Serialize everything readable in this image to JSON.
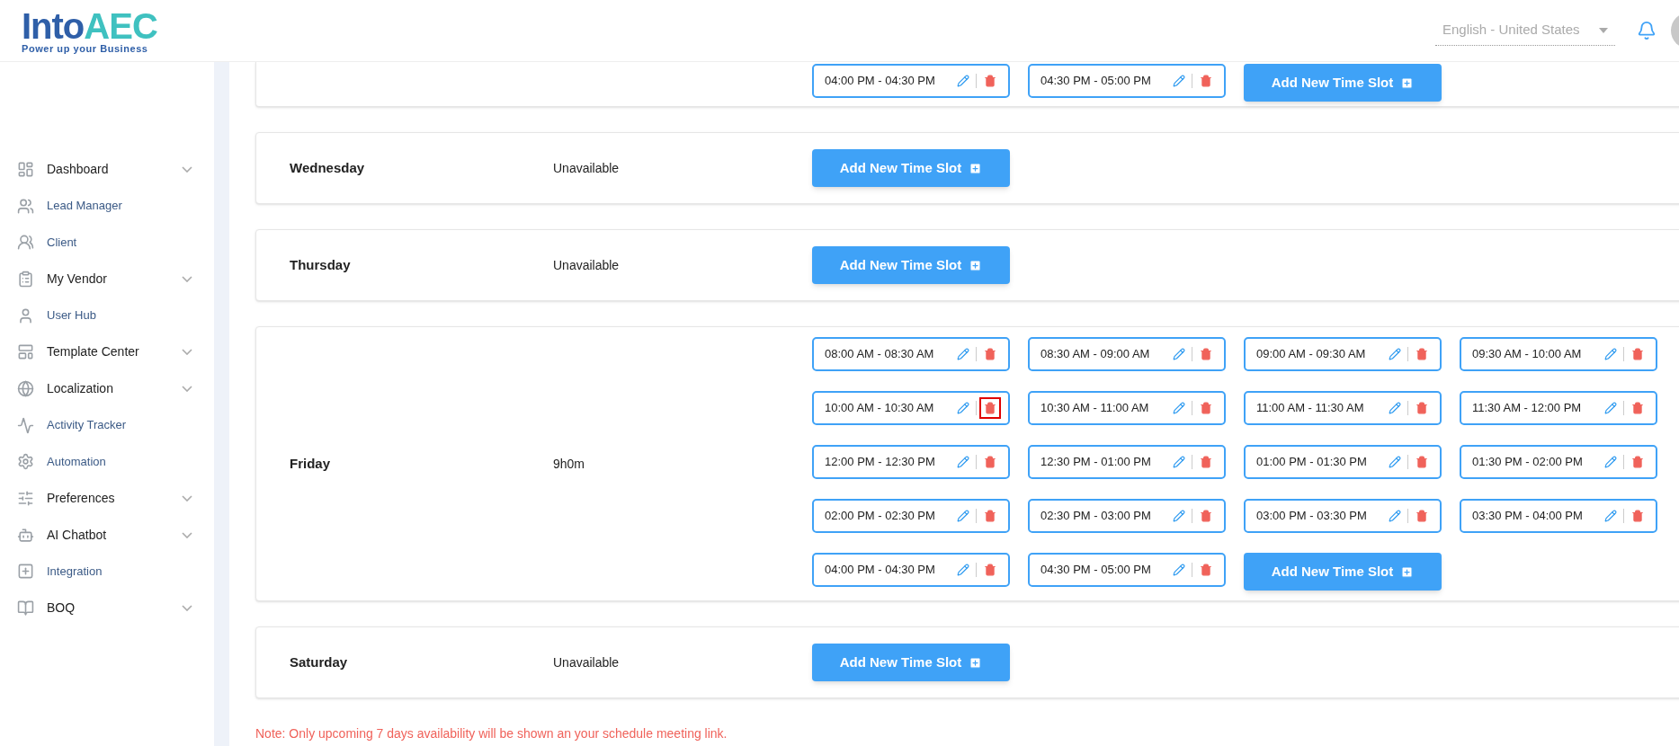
{
  "brand": {
    "name_start": "Into",
    "name_end": "AEC",
    "tagline": "Power up your Business"
  },
  "header": {
    "language": "English - United States"
  },
  "sidebar": {
    "items": [
      {
        "label": "Dashboard",
        "kind": "group"
      },
      {
        "label": "Lead Manager",
        "kind": "link"
      },
      {
        "label": "Client",
        "kind": "link"
      },
      {
        "label": "My Vendor",
        "kind": "group"
      },
      {
        "label": "User Hub",
        "kind": "link"
      },
      {
        "label": "Template Center",
        "kind": "group"
      },
      {
        "label": "Localization",
        "kind": "group"
      },
      {
        "label": "Activity Tracker",
        "kind": "link"
      },
      {
        "label": "Automation",
        "kind": "link"
      },
      {
        "label": "Preferences",
        "kind": "group"
      },
      {
        "label": "AI Chatbot",
        "kind": "group"
      },
      {
        "label": "Integration",
        "kind": "link"
      },
      {
        "label": "BOQ",
        "kind": "group"
      }
    ]
  },
  "clipped_card": {
    "slots": [
      {
        "time": "04:00 PM - 04:30 PM",
        "delete_focused": false
      },
      {
        "time": "04:30 PM - 05:00 PM",
        "delete_focused": false
      }
    ],
    "add_button": "Add New Time Slot"
  },
  "days": [
    {
      "day": "Wednesday",
      "status": "Unavailable",
      "add_button": "Add New Time Slot"
    },
    {
      "day": "Thursday",
      "status": "Unavailable",
      "add_button": "Add New Time Slot"
    },
    {
      "day": "Friday",
      "status": "9h0m",
      "slots": [
        {
          "time": "08:00 AM - 08:30 AM",
          "delete_focused": false
        },
        {
          "time": "08:30 AM - 09:00 AM",
          "delete_focused": false
        },
        {
          "time": "09:00 AM - 09:30 AM",
          "delete_focused": false
        },
        {
          "time": "09:30 AM - 10:00 AM",
          "delete_focused": false
        },
        {
          "time": "10:00 AM - 10:30 AM",
          "delete_focused": true
        },
        {
          "time": "10:30 AM - 11:00 AM",
          "delete_focused": false
        },
        {
          "time": "11:00 AM - 11:30 AM",
          "delete_focused": false
        },
        {
          "time": "11:30 AM - 12:00 PM",
          "delete_focused": false
        },
        {
          "time": "12:00 PM - 12:30 PM",
          "delete_focused": false
        },
        {
          "time": "12:30 PM - 01:00 PM",
          "delete_focused": false
        },
        {
          "time": "01:00 PM - 01:30 PM",
          "delete_focused": false
        },
        {
          "time": "01:30 PM - 02:00 PM",
          "delete_focused": false
        },
        {
          "time": "02:00 PM - 02:30 PM",
          "delete_focused": false
        },
        {
          "time": "02:30 PM - 03:00 PM",
          "delete_focused": false
        },
        {
          "time": "03:00 PM - 03:30 PM",
          "delete_focused": false
        },
        {
          "time": "03:30 PM - 04:00 PM",
          "delete_focused": false
        },
        {
          "time": "04:00 PM - 04:30 PM",
          "delete_focused": false
        },
        {
          "time": "04:30 PM - 05:00 PM",
          "delete_focused": false
        }
      ],
      "add_button": "Add New Time Slot"
    },
    {
      "day": "Saturday",
      "status": "Unavailable",
      "add_button": "Add New Time Slot"
    }
  ],
  "note": "Note: Only upcoming 7 days availability will be shown an your schedule meeting link."
}
